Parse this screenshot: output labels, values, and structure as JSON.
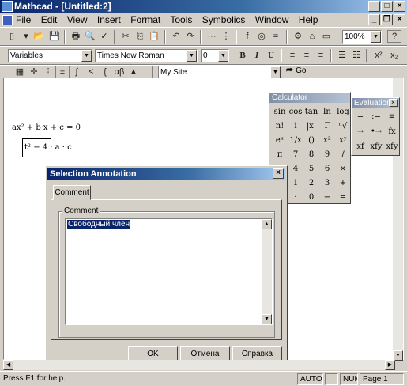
{
  "window": {
    "title": "Mathcad - [Untitled:2]"
  },
  "menu": [
    "File",
    "Edit",
    "View",
    "Insert",
    "Format",
    "Tools",
    "Symbolics",
    "Window",
    "Help"
  ],
  "toolbar": {
    "zoom": "100%",
    "help_label": "?"
  },
  "format_bar": {
    "style": "Variables",
    "font": "Times New Roman",
    "size": "0",
    "bold": "B",
    "italic": "I",
    "underline": "U",
    "superscript": "x²",
    "subscript": "x₂"
  },
  "math_bar": {
    "resource": "My Site",
    "go": "Go"
  },
  "document": {
    "eq1": "ax² + b·x + c = 0",
    "eq2": "t² − 4 · a · c"
  },
  "calculator": {
    "title": "Calculator",
    "keys": [
      "sin",
      "cos",
      "tan",
      "ln",
      "log",
      "n!",
      "i",
      "|x|",
      "Γ",
      "ⁿ√",
      "eˣ",
      "1/x",
      "()",
      "x²",
      "xʸ",
      "π",
      "7",
      "8",
      "9",
      "/",
      "",
      "4",
      "5",
      "6",
      "×",
      "",
      "1",
      "2",
      "3",
      "+",
      "",
      "·",
      "0",
      "−",
      "="
    ]
  },
  "evaluation": {
    "title": "Evaluation",
    "keys": [
      "=",
      ":=",
      "≡",
      "→",
      "•→",
      "fx",
      "xf",
      "xfy",
      "xfy"
    ]
  },
  "dialog": {
    "title": "Selection Annotation",
    "tab": "Comment",
    "group_label": "Comment",
    "text": "Свободный член",
    "ok": "OK",
    "cancel": "Отмена",
    "help": "Справка"
  },
  "status": {
    "help": "Press F1 for help.",
    "auto": "AUTO",
    "num": "NUM",
    "page": "Page 1"
  }
}
